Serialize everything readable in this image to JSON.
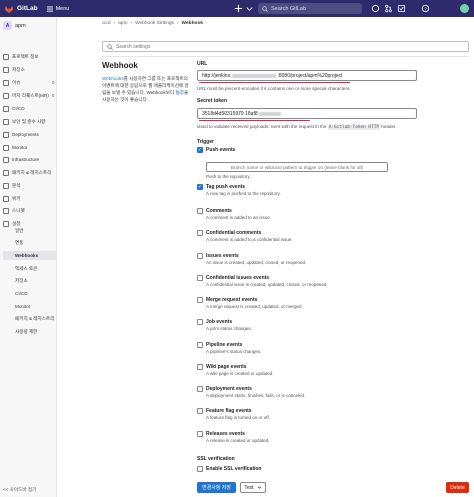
{
  "topbar": {
    "brand": "GitLab",
    "menu_label": "Menu",
    "search_placeholder": "Search GitLab"
  },
  "sidebar": {
    "project_initial": "A",
    "project_name": "apm",
    "items": [
      {
        "label": "프로젝트 정보",
        "icon": "info-icon"
      },
      {
        "label": "저장소",
        "icon": "doc-icon"
      },
      {
        "label": "이슈",
        "icon": "issues-icon",
        "badge": "0"
      },
      {
        "label": "머지 리퀘스트(MR)",
        "icon": "merge-icon",
        "badge": "0"
      },
      {
        "label": "CI/CD",
        "icon": "rocket-icon"
      },
      {
        "label": "보안 및 준수 사항",
        "icon": "shield-icon"
      },
      {
        "label": "Deployments",
        "icon": "deploy-icon"
      },
      {
        "label": "Monitor",
        "icon": "monitor-icon"
      },
      {
        "label": "Infrastructure",
        "icon": "cloud-icon"
      },
      {
        "label": "패키지 & 레지스트리",
        "icon": "package-icon"
      },
      {
        "label": "분석",
        "icon": "chart-icon"
      },
      {
        "label": "위키",
        "icon": "book-icon"
      },
      {
        "label": "스니펫",
        "icon": "snippet-icon"
      },
      {
        "label": "설정",
        "icon": "gear-icon"
      }
    ],
    "sub_items": [
      "일반",
      "연동",
      "Webhooks",
      "액세스 토큰",
      "저장소",
      "CI/CD",
      "Monitor",
      "패키지 & 레지스트리",
      "사용량 제한"
    ],
    "collapse_label": "<< 사이드바 접기"
  },
  "breadcrumb": [
    "cicd",
    "apm",
    "Webhook Settings",
    "Webhook"
  ],
  "settings_search_placeholder": "Search settings",
  "page": {
    "title": "Webhook",
    "description_link": "Webhooks",
    "description_1": "를 사용하면 그룹 또는 프로젝트의 이벤트에 대한 응답으로 웹 애플리케이션에 알림을 보낼 수 있습니다. Webhook보다 ",
    "description_link2": "통합",
    "description_2": "을 사용하는 것이 좋습니다."
  },
  "form": {
    "url_label": "URL",
    "url_value_start": "http://jenkins.",
    "url_value_end": ":8080/project/apm%20project",
    "url_help": "URL must be percent-encoded if it contains one or more special characters.",
    "token_label": "Secret token",
    "token_value_start": "3518d4d50315979 18af8",
    "token_help_1": "Used to validate received payloads. Sent with the request in the ",
    "token_help_code": "X-Gitlab-Token HTTP",
    "token_help_2": " header.",
    "trigger_label": "Trigger",
    "branch_placeholder": "Branch name or wildcard pattern to trigger on (leave blank for all)",
    "triggers": [
      {
        "name": "Push events",
        "desc": "Push to the repository.",
        "checked": true
      },
      {
        "name": "Tag push events",
        "desc": "A new tag is pushed to the repository.",
        "checked": true
      },
      {
        "name": "Comments",
        "desc": "A comment is added to an issue.",
        "checked": false
      },
      {
        "name": "Confidential comments",
        "desc": "A comment is added to a confidential issue.",
        "checked": false
      },
      {
        "name": "Issues events",
        "desc": "An issue is created, updated, closed, or reopened.",
        "checked": false
      },
      {
        "name": "Confidential issues events",
        "desc": "A confidential issue is created, updated, closed, or reopened.",
        "checked": false
      },
      {
        "name": "Merge request events",
        "desc": "A merge request is created, updated, or merged.",
        "checked": false
      },
      {
        "name": "Job events",
        "desc": "A job's status changes.",
        "checked": false
      },
      {
        "name": "Pipeline events",
        "desc": "A pipeline's status changes.",
        "checked": false
      },
      {
        "name": "Wiki page events",
        "desc": "A wiki page is created or updated.",
        "checked": false
      },
      {
        "name": "Deployment events",
        "desc": "A deployment starts, finishes, fails, or is canceled.",
        "checked": false
      },
      {
        "name": "Feature flag events",
        "desc": "A feature flag is turned on or off.",
        "checked": false
      },
      {
        "name": "Releases events",
        "desc": "A release is created or updated.",
        "checked": false
      }
    ],
    "ssl_label": "SSL verification",
    "ssl_option": "Enable SSL verification",
    "ssl_checked": false
  },
  "buttons": {
    "save": "변경사항 저장",
    "test": "Test",
    "delete": "Delete"
  },
  "colors": {
    "topbar": "#2f2a6b",
    "primary": "#1f75cb",
    "danger": "#dd2b0e",
    "annotation": "#d8265a"
  }
}
